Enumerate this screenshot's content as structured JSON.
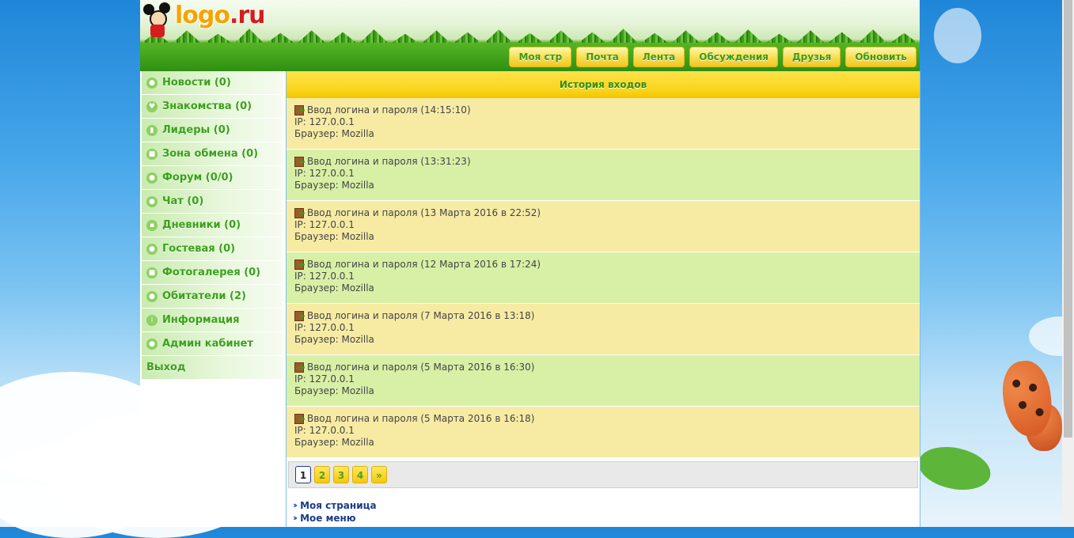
{
  "logo": {
    "main": "logo",
    "tld": ".ru"
  },
  "topnav": [
    {
      "label": "Моя стр"
    },
    {
      "label": "Почта"
    },
    {
      "label": "Лента"
    },
    {
      "label": "Обсуждения"
    },
    {
      "label": "Друзья"
    },
    {
      "label": "Обновить"
    }
  ],
  "sidebar": [
    {
      "label": "Новости (0)",
      "icon": "rss-icon"
    },
    {
      "label": "Знакомства (0)",
      "icon": "heart-icon"
    },
    {
      "label": "Лидеры (0)",
      "icon": "bar-chart-icon"
    },
    {
      "label": "Зона обмена (0)",
      "icon": "disk-icon"
    },
    {
      "label": "Форум (0/0)",
      "icon": "chat-bubble-icon"
    },
    {
      "label": "Чат (0)",
      "icon": "chat-icon"
    },
    {
      "label": "Дневники (0)",
      "icon": "document-icon"
    },
    {
      "label": "Гостевая (0)",
      "icon": "user-icon"
    },
    {
      "label": "Фотогалерея (0)",
      "icon": "photo-icon"
    },
    {
      "label": "Обитатели (2)",
      "icon": "users-icon"
    },
    {
      "label": "Информация",
      "icon": "info-icon"
    },
    {
      "label": "Админ кабинет",
      "icon": "admin-icon"
    },
    {
      "label": "Выход"
    }
  ],
  "content": {
    "title": "История входов",
    "entries": [
      {
        "head": "Ввод логина и пароля (14:15:10)",
        "ip": "IP: 127.0.0.1",
        "browser": "Браузер: Mozilla"
      },
      {
        "head": "Ввод логина и пароля (13:31:23)",
        "ip": "IP: 127.0.0.1",
        "browser": "Браузер: Mozilla"
      },
      {
        "head": "Ввод логина и пароля (13 Марта 2016 в 22:52)",
        "ip": "IP: 127.0.0.1",
        "browser": "Браузер: Mozilla"
      },
      {
        "head": "Ввод логина и пароля (12 Марта 2016 в 17:24)",
        "ip": "IP: 127.0.0.1",
        "browser": "Браузер: Mozilla"
      },
      {
        "head": "Ввод логина и пароля (7 Марта 2016 в 13:18)",
        "ip": "IP: 127.0.0.1",
        "browser": "Браузер: Mozilla"
      },
      {
        "head": "Ввод логина и пароля (5 Марта 2016 в 16:30)",
        "ip": "IP: 127.0.0.1",
        "browser": "Браузер: Mozilla"
      },
      {
        "head": "Ввод логина и пароля (5 Марта 2016 в 16:18)",
        "ip": "IP: 127.0.0.1",
        "browser": "Браузер: Mozilla"
      }
    ],
    "pager": [
      "1",
      "2",
      "3",
      "4",
      "»"
    ],
    "current_page": "1"
  },
  "footlinks": [
    {
      "label": "Моя страница"
    },
    {
      "label": "Мое меню"
    }
  ],
  "colors": {
    "accent_green": "#3aa11a",
    "nav_yellow": "#f7d948",
    "row_yellow": "#f7eba4",
    "row_green": "#d8f0a6"
  }
}
